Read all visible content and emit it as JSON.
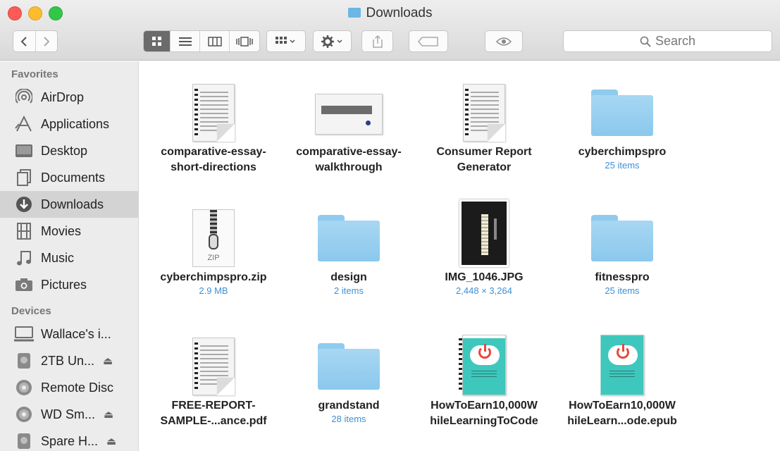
{
  "window": {
    "title": "Downloads"
  },
  "search": {
    "placeholder": "Search"
  },
  "sidebar": {
    "favorites_header": "Favorites",
    "favorites": [
      {
        "label": "AirDrop",
        "icon": "airdrop-icon"
      },
      {
        "label": "Applications",
        "icon": "applications-icon"
      },
      {
        "label": "Desktop",
        "icon": "desktop-icon"
      },
      {
        "label": "Documents",
        "icon": "documents-icon"
      },
      {
        "label": "Downloads",
        "icon": "downloads-icon",
        "selected": true
      },
      {
        "label": "Movies",
        "icon": "movies-icon"
      },
      {
        "label": "Music",
        "icon": "music-icon"
      },
      {
        "label": "Pictures",
        "icon": "pictures-icon"
      }
    ],
    "devices_header": "Devices",
    "devices": [
      {
        "label": "Wallace's i...",
        "icon": "computer-icon"
      },
      {
        "label": "2TB Un...",
        "icon": "drive-icon",
        "eject": "⏏"
      },
      {
        "label": "Remote Disc",
        "icon": "disc-icon"
      },
      {
        "label": "WD Sm...",
        "icon": "disc-icon",
        "eject": "⏏"
      },
      {
        "label": "Spare H...",
        "icon": "drive-icon",
        "eject": "⏏"
      }
    ]
  },
  "files": [
    {
      "name_line1": "comparative-essay-",
      "name_line2": "short-directions",
      "sub": "",
      "kind": "document"
    },
    {
      "name_line1": "comparative-essay-",
      "name_line2": "walkthrough",
      "sub": "",
      "kind": "document-wide"
    },
    {
      "name_line1": "Consumer Report",
      "name_line2": "Generator",
      "sub": "",
      "kind": "document"
    },
    {
      "name_line1": "cyberchimpspro",
      "name_line2": "",
      "sub": "25 items",
      "kind": "folder"
    },
    {
      "name_line1": "cyberchimpspro.zip",
      "name_line2": "",
      "sub": "2.9 MB",
      "kind": "zip",
      "zip_label": "ZIP"
    },
    {
      "name_line1": "design",
      "name_line2": "",
      "sub": "2 items",
      "kind": "folder"
    },
    {
      "name_line1": "IMG_1046.JPG",
      "name_line2": "",
      "sub": "2,448 × 3,264",
      "kind": "photo"
    },
    {
      "name_line1": "fitnesspro",
      "name_line2": "",
      "sub": "25 items",
      "kind": "folder"
    },
    {
      "name_line1": "FREE-REPORT-",
      "name_line2": "SAMPLE-...ance.pdf",
      "sub": "",
      "kind": "document"
    },
    {
      "name_line1": "grandstand",
      "name_line2": "",
      "sub": "28 items",
      "kind": "folder"
    },
    {
      "name_line1": "HowToEarn10,000W",
      "name_line2": "hileLearningToCode",
      "sub": "",
      "kind": "epub-bound"
    },
    {
      "name_line1": "HowToEarn10,000W",
      "name_line2": "hileLearn...ode.epub",
      "sub": "",
      "kind": "epub"
    }
  ],
  "colors": {
    "folder": "#8bc8ec",
    "subtext": "#3e8fd6",
    "sidebar_selected": "#d3d3d3"
  }
}
